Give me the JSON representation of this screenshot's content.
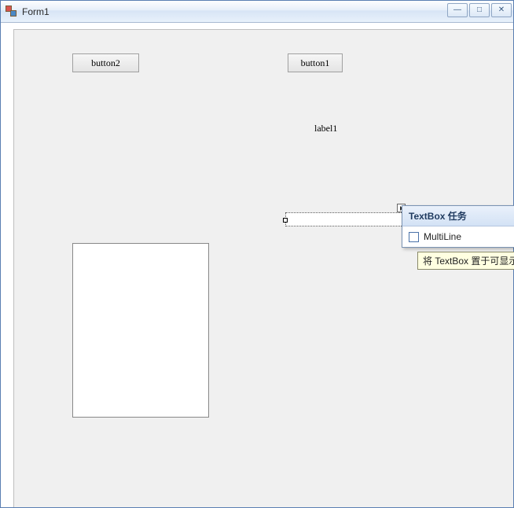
{
  "window": {
    "title": "Form1"
  },
  "buttons": {
    "button1_label": "button1",
    "button2_label": "button2"
  },
  "label1_text": "label1",
  "textbox1_value": "",
  "smarttag": {
    "title": "TextBox 任务",
    "multiline_label": "MultiLine",
    "multiline_checked": false
  },
  "tooltip_text": "将 TextBox 置于可显示",
  "win_controls": {
    "minimize": "—",
    "maximize": "□",
    "close": "✕"
  }
}
